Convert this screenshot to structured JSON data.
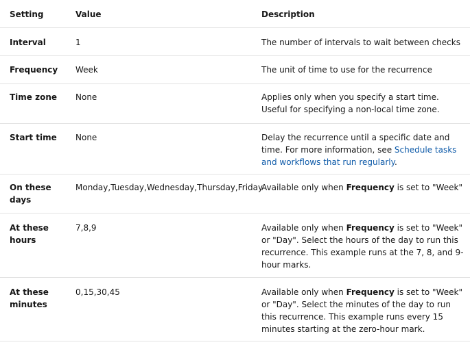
{
  "table": {
    "headers": {
      "setting": "Setting",
      "value": "Value",
      "description": "Description"
    },
    "rows": [
      {
        "setting": "Interval",
        "value": "1",
        "description": "The number of intervals to wait between checks"
      },
      {
        "setting": "Frequency",
        "value": "Week",
        "description": "The unit of time to use for the recurrence"
      },
      {
        "setting": "Time zone",
        "value": "None",
        "description": "Applies only when you specify a start time. Useful for specifying a non-local time zone."
      },
      {
        "setting": "Start time",
        "value": "None",
        "description_pre": "Delay the recurrence until a specific date and time. For more information, see ",
        "description_link": "Schedule tasks and workflows that run regularly",
        "description_post": "."
      },
      {
        "setting": "On these days",
        "value": "Monday,Tuesday,Wednesday,Thursday,Friday",
        "description_pre": "Available only when ",
        "description_bold": "Frequency",
        "description_post": " is set to \"Week\""
      },
      {
        "setting": "At these hours",
        "value": "7,8,9",
        "description_pre": "Available only when ",
        "description_bold": "Frequency",
        "description_post": " is set to \"Week\" or \"Day\". Select the hours of the day to run this recurrence. This example runs at the 7, 8, and 9-hour marks."
      },
      {
        "setting": "At these minutes",
        "value": "0,15,30,45",
        "description_pre": "Available only when ",
        "description_bold": "Frequency",
        "description_post": " is set to \"Week\" or \"Day\". Select the minutes of the day to run this recurrence. This example runs every 15 minutes starting at the zero-hour mark."
      }
    ]
  },
  "colors": {
    "text": "#171717",
    "link": "#0f5ba9",
    "divider": "#e3e3e3"
  }
}
